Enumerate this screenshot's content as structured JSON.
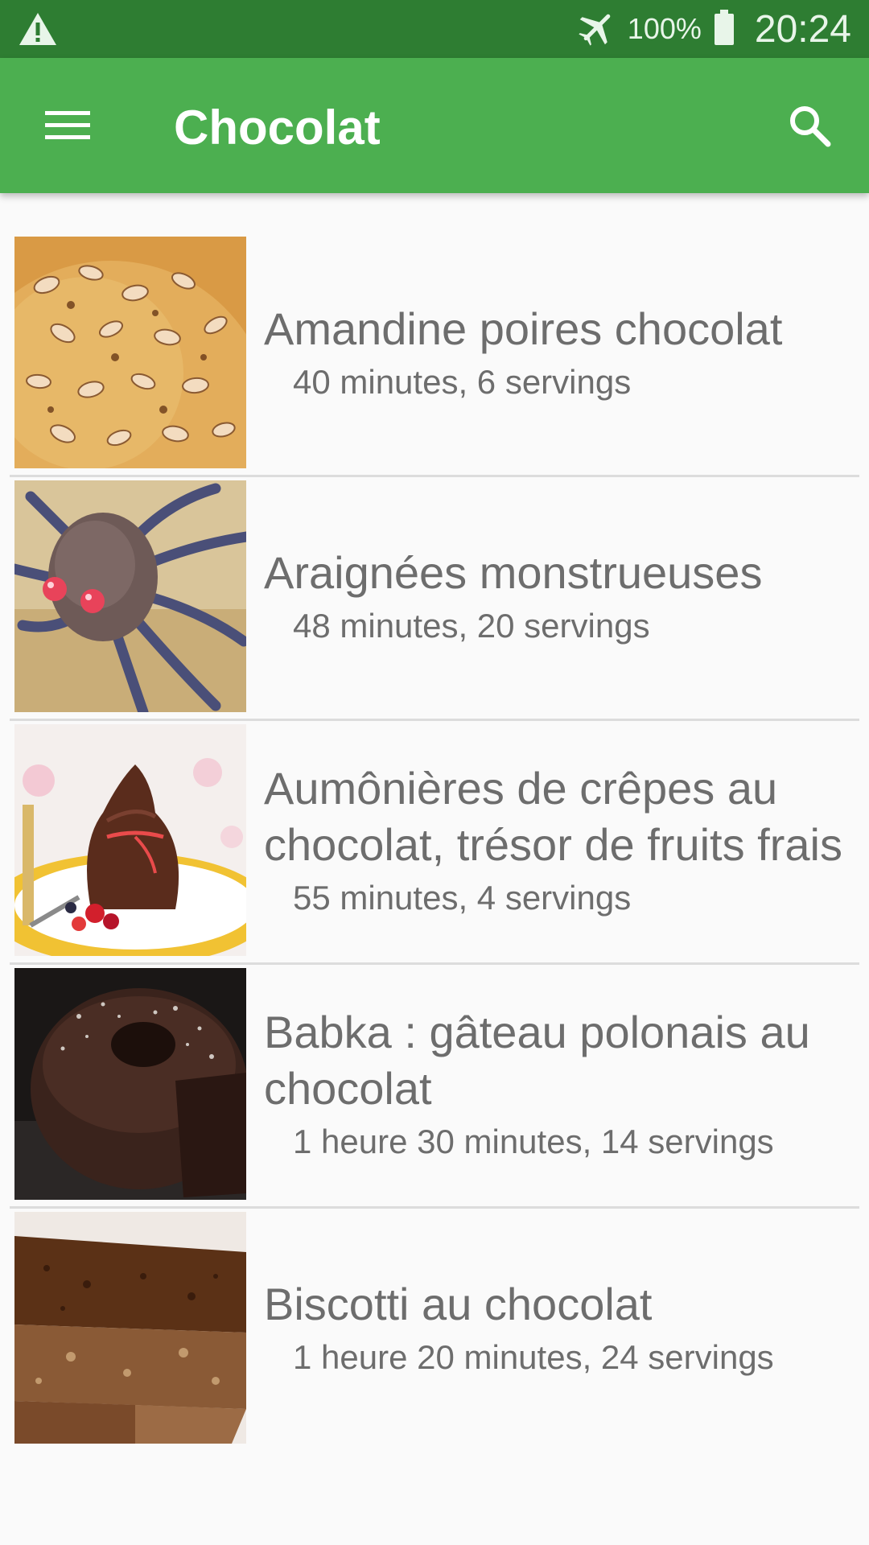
{
  "status_bar": {
    "icons": [
      "warning-icon",
      "airplane-mode-icon",
      "battery-icon"
    ],
    "battery": "100%",
    "time": "20:24"
  },
  "app_bar": {
    "title": "Chocolat",
    "menu_icon": "hamburger-menu-icon",
    "search_icon": "search-icon",
    "color": "#4caf50"
  },
  "recipes": [
    {
      "title": "Amandine poires chocolat",
      "meta": "40 minutes, 6 servings"
    },
    {
      "title": "Araignées monstrueuses",
      "meta": "48 minutes, 20 servings"
    },
    {
      "title": "Aumônières de crêpes au chocolat, trésor de fruits frais",
      "meta": "55 minutes, 4 servings"
    },
    {
      "title": "Babka : gâteau polonais au chocolat",
      "meta": "1 heure 30 minutes, 14 servings"
    },
    {
      "title": "Biscotti au chocolat",
      "meta": "1 heure 20 minutes, 24 servings"
    }
  ]
}
